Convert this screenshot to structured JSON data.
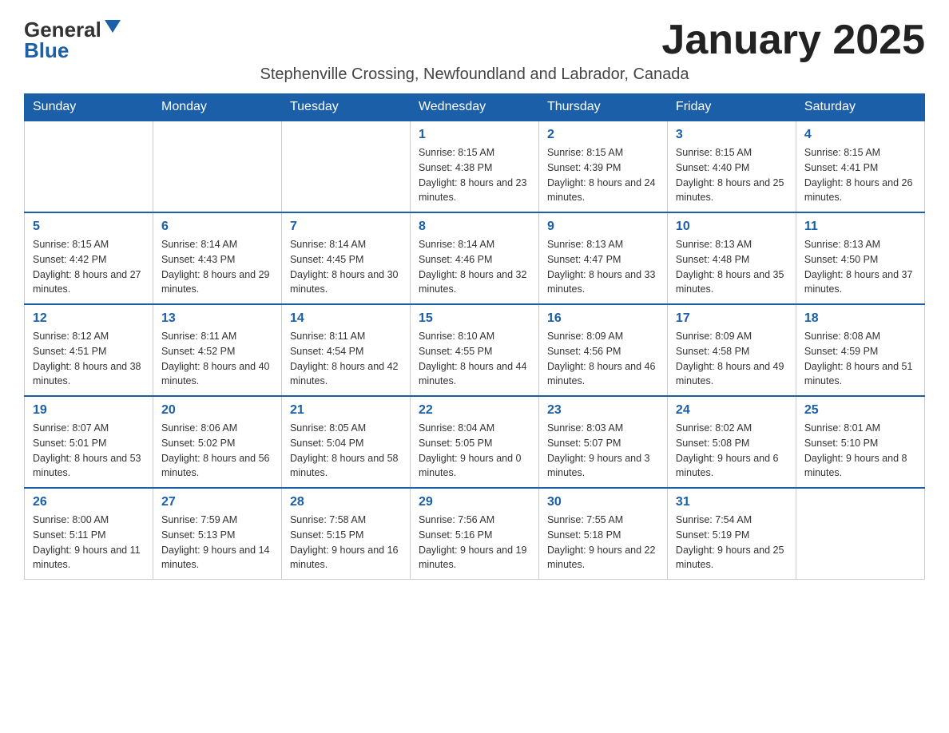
{
  "header": {
    "logo_general": "General",
    "logo_blue": "Blue",
    "month_title": "January 2025",
    "subtitle": "Stephenville Crossing, Newfoundland and Labrador, Canada"
  },
  "weekdays": [
    "Sunday",
    "Monday",
    "Tuesday",
    "Wednesday",
    "Thursday",
    "Friday",
    "Saturday"
  ],
  "weeks": [
    [
      {
        "day": "",
        "info": ""
      },
      {
        "day": "",
        "info": ""
      },
      {
        "day": "",
        "info": ""
      },
      {
        "day": "1",
        "info": "Sunrise: 8:15 AM\nSunset: 4:38 PM\nDaylight: 8 hours\nand 23 minutes."
      },
      {
        "day": "2",
        "info": "Sunrise: 8:15 AM\nSunset: 4:39 PM\nDaylight: 8 hours\nand 24 minutes."
      },
      {
        "day": "3",
        "info": "Sunrise: 8:15 AM\nSunset: 4:40 PM\nDaylight: 8 hours\nand 25 minutes."
      },
      {
        "day": "4",
        "info": "Sunrise: 8:15 AM\nSunset: 4:41 PM\nDaylight: 8 hours\nand 26 minutes."
      }
    ],
    [
      {
        "day": "5",
        "info": "Sunrise: 8:15 AM\nSunset: 4:42 PM\nDaylight: 8 hours\nand 27 minutes."
      },
      {
        "day": "6",
        "info": "Sunrise: 8:14 AM\nSunset: 4:43 PM\nDaylight: 8 hours\nand 29 minutes."
      },
      {
        "day": "7",
        "info": "Sunrise: 8:14 AM\nSunset: 4:45 PM\nDaylight: 8 hours\nand 30 minutes."
      },
      {
        "day": "8",
        "info": "Sunrise: 8:14 AM\nSunset: 4:46 PM\nDaylight: 8 hours\nand 32 minutes."
      },
      {
        "day": "9",
        "info": "Sunrise: 8:13 AM\nSunset: 4:47 PM\nDaylight: 8 hours\nand 33 minutes."
      },
      {
        "day": "10",
        "info": "Sunrise: 8:13 AM\nSunset: 4:48 PM\nDaylight: 8 hours\nand 35 minutes."
      },
      {
        "day": "11",
        "info": "Sunrise: 8:13 AM\nSunset: 4:50 PM\nDaylight: 8 hours\nand 37 minutes."
      }
    ],
    [
      {
        "day": "12",
        "info": "Sunrise: 8:12 AM\nSunset: 4:51 PM\nDaylight: 8 hours\nand 38 minutes."
      },
      {
        "day": "13",
        "info": "Sunrise: 8:11 AM\nSunset: 4:52 PM\nDaylight: 8 hours\nand 40 minutes."
      },
      {
        "day": "14",
        "info": "Sunrise: 8:11 AM\nSunset: 4:54 PM\nDaylight: 8 hours\nand 42 minutes."
      },
      {
        "day": "15",
        "info": "Sunrise: 8:10 AM\nSunset: 4:55 PM\nDaylight: 8 hours\nand 44 minutes."
      },
      {
        "day": "16",
        "info": "Sunrise: 8:09 AM\nSunset: 4:56 PM\nDaylight: 8 hours\nand 46 minutes."
      },
      {
        "day": "17",
        "info": "Sunrise: 8:09 AM\nSunset: 4:58 PM\nDaylight: 8 hours\nand 49 minutes."
      },
      {
        "day": "18",
        "info": "Sunrise: 8:08 AM\nSunset: 4:59 PM\nDaylight: 8 hours\nand 51 minutes."
      }
    ],
    [
      {
        "day": "19",
        "info": "Sunrise: 8:07 AM\nSunset: 5:01 PM\nDaylight: 8 hours\nand 53 minutes."
      },
      {
        "day": "20",
        "info": "Sunrise: 8:06 AM\nSunset: 5:02 PM\nDaylight: 8 hours\nand 56 minutes."
      },
      {
        "day": "21",
        "info": "Sunrise: 8:05 AM\nSunset: 5:04 PM\nDaylight: 8 hours\nand 58 minutes."
      },
      {
        "day": "22",
        "info": "Sunrise: 8:04 AM\nSunset: 5:05 PM\nDaylight: 9 hours\nand 0 minutes."
      },
      {
        "day": "23",
        "info": "Sunrise: 8:03 AM\nSunset: 5:07 PM\nDaylight: 9 hours\nand 3 minutes."
      },
      {
        "day": "24",
        "info": "Sunrise: 8:02 AM\nSunset: 5:08 PM\nDaylight: 9 hours\nand 6 minutes."
      },
      {
        "day": "25",
        "info": "Sunrise: 8:01 AM\nSunset: 5:10 PM\nDaylight: 9 hours\nand 8 minutes."
      }
    ],
    [
      {
        "day": "26",
        "info": "Sunrise: 8:00 AM\nSunset: 5:11 PM\nDaylight: 9 hours\nand 11 minutes."
      },
      {
        "day": "27",
        "info": "Sunrise: 7:59 AM\nSunset: 5:13 PM\nDaylight: 9 hours\nand 14 minutes."
      },
      {
        "day": "28",
        "info": "Sunrise: 7:58 AM\nSunset: 5:15 PM\nDaylight: 9 hours\nand 16 minutes."
      },
      {
        "day": "29",
        "info": "Sunrise: 7:56 AM\nSunset: 5:16 PM\nDaylight: 9 hours\nand 19 minutes."
      },
      {
        "day": "30",
        "info": "Sunrise: 7:55 AM\nSunset: 5:18 PM\nDaylight: 9 hours\nand 22 minutes."
      },
      {
        "day": "31",
        "info": "Sunrise: 7:54 AM\nSunset: 5:19 PM\nDaylight: 9 hours\nand 25 minutes."
      },
      {
        "day": "",
        "info": ""
      }
    ]
  ]
}
